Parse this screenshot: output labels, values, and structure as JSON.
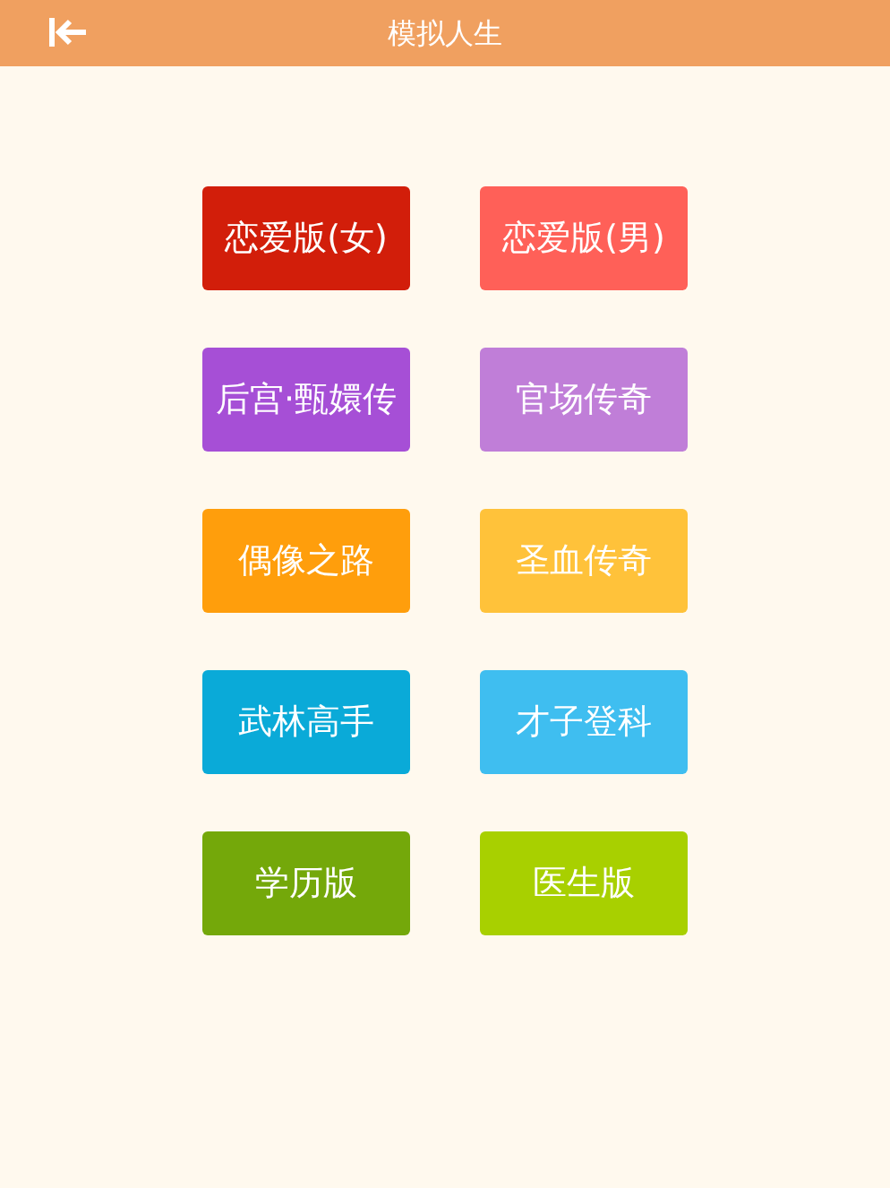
{
  "header": {
    "title": "模拟人生"
  },
  "versions": [
    {
      "label": "恋爱版(女)",
      "color": "#d21e0a"
    },
    {
      "label": "恋爱版(男)",
      "color": "#ff6058"
    },
    {
      "label": "后宫·甄嬛传",
      "color": "#a64fd6"
    },
    {
      "label": "官场传奇",
      "color": "#c07ed8"
    },
    {
      "label": "偶像之路",
      "color": "#ff9e0c"
    },
    {
      "label": "圣血传奇",
      "color": "#ffc23a"
    },
    {
      "label": "武林高手",
      "color": "#0aaad8"
    },
    {
      "label": "才子登科",
      "color": "#3fbef0"
    },
    {
      "label": "学历版",
      "color": "#74a80a"
    },
    {
      "label": "医生版",
      "color": "#a8d000"
    }
  ]
}
